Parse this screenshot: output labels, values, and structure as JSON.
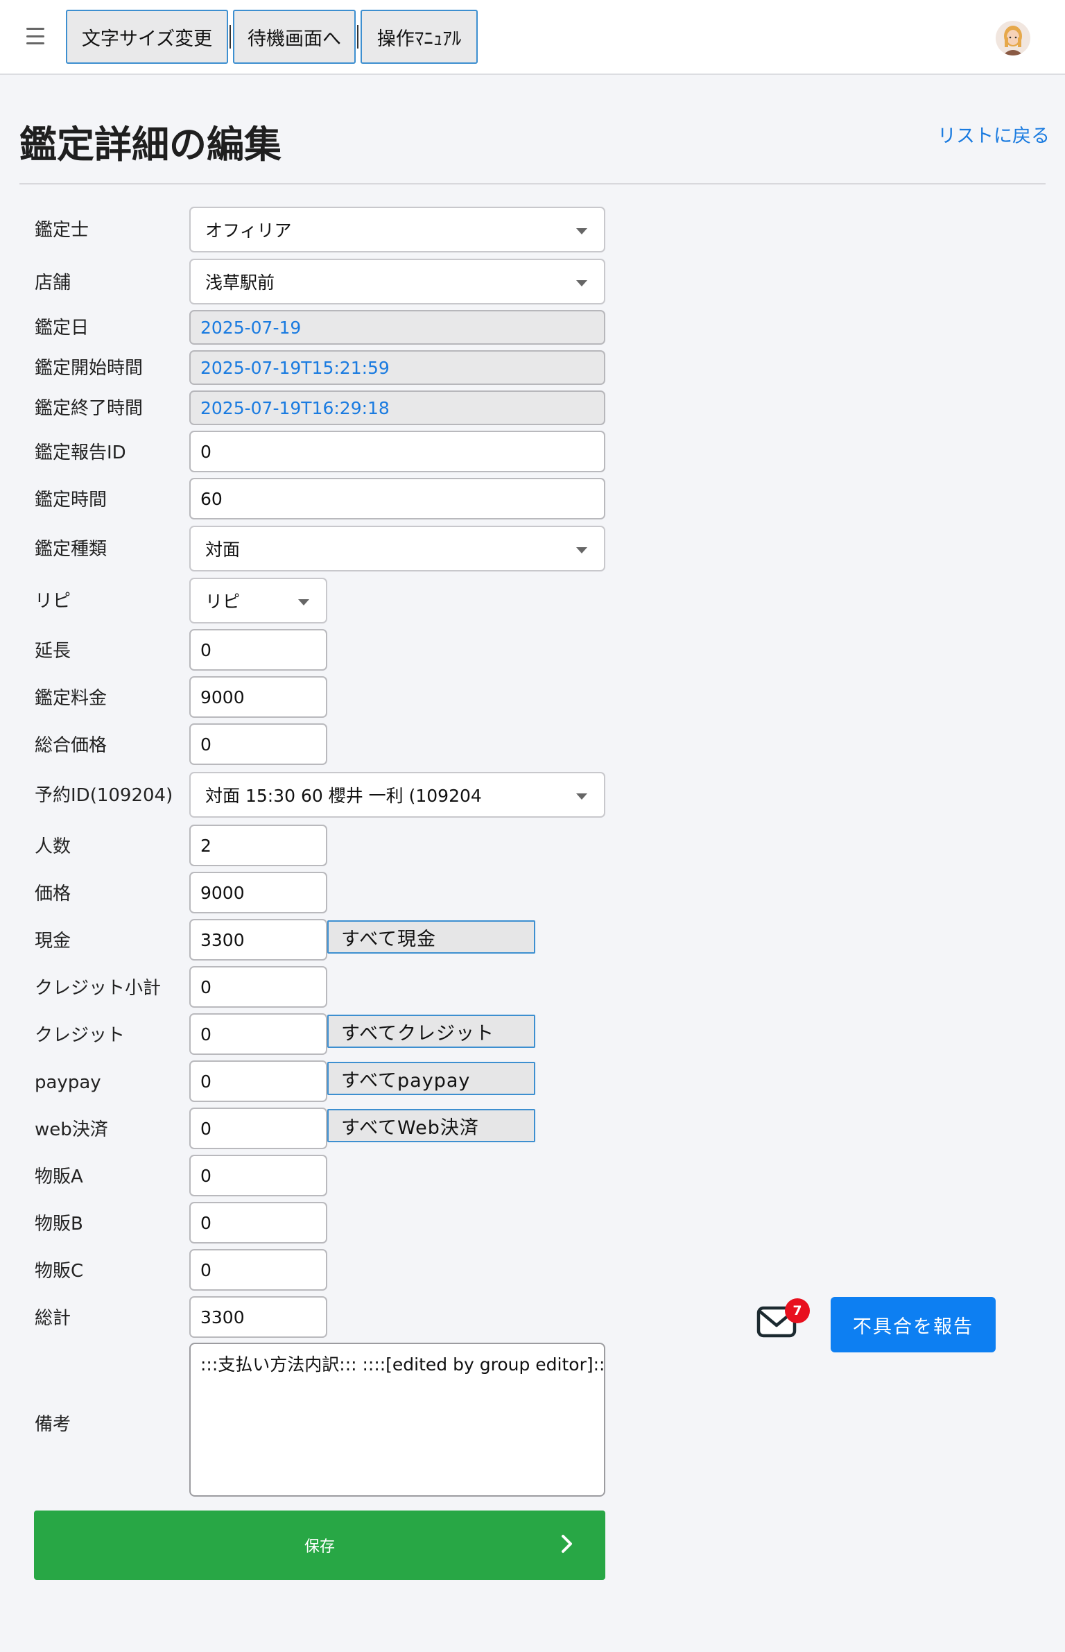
{
  "header": {
    "menu_icon": "hamburger-menu-icon",
    "buttons": [
      "文字サイズ変更",
      "待機画面へ",
      "操作ﾏﾆｭｱﾙ"
    ],
    "avatar_icon": "user-avatar-icon"
  },
  "page": {
    "title": "鑑定詳細の編集",
    "back_link": "リストに戻る"
  },
  "form": {
    "fortune_teller": {
      "label": "鑑定士",
      "value": "オフィリア"
    },
    "store": {
      "label": "店舗",
      "value": "浅草駅前"
    },
    "date": {
      "label": "鑑定日",
      "value": "2025-07-19"
    },
    "start_time": {
      "label": "鑑定開始時間",
      "value": "2025-07-19T15:21:59"
    },
    "end_time": {
      "label": "鑑定終了時間",
      "value": "2025-07-19T16:29:18"
    },
    "report_id": {
      "label": "鑑定報告ID",
      "value": "0"
    },
    "duration": {
      "label": "鑑定時間",
      "value": "60"
    },
    "type": {
      "label": "鑑定種類",
      "value": "対面"
    },
    "repeat": {
      "label": "リピ",
      "value": "リピ"
    },
    "extension": {
      "label": "延長",
      "value": "0"
    },
    "fee": {
      "label": "鑑定料金",
      "value": "9000"
    },
    "total_price": {
      "label": "総合価格",
      "value": "0"
    },
    "reservation": {
      "label": "予約ID(109204)",
      "value": "対面 15:30 60 櫻井 一利 (109204"
    },
    "people": {
      "label": "人数",
      "value": "2"
    },
    "price": {
      "label": "価格",
      "value": "9000"
    },
    "cash": {
      "label": "現金",
      "value": "3300",
      "all_button": "すべて現金"
    },
    "credit_subtotal": {
      "label": "クレジット小計",
      "value": "0"
    },
    "credit": {
      "label": "クレジット",
      "value": "0",
      "all_button": "すべてクレジット"
    },
    "paypay": {
      "label": "paypay",
      "value": "0",
      "all_button": "すべてpaypay"
    },
    "web_payment": {
      "label": "web決済",
      "value": "0",
      "all_button": "すべてWeb決済"
    },
    "goods_a": {
      "label": "物販A",
      "value": "0"
    },
    "goods_b": {
      "label": "物販B",
      "value": "0"
    },
    "goods_c": {
      "label": "物販C",
      "value": "0"
    },
    "grand_total": {
      "label": "総計",
      "value": "3300"
    },
    "notes": {
      "label": "備考",
      "value": ":::支払い方法内訳::: ::::[edited by group editor]::: :"
    },
    "save_label": "保存"
  },
  "floating": {
    "mail_icon": "mail-icon",
    "mail_badge": "7",
    "report_button": "不具合を報告"
  },
  "colors": {
    "accent": "#1a7be0",
    "save": "#28a745",
    "report": "#0d7ff2",
    "badge": "#e8101e"
  }
}
